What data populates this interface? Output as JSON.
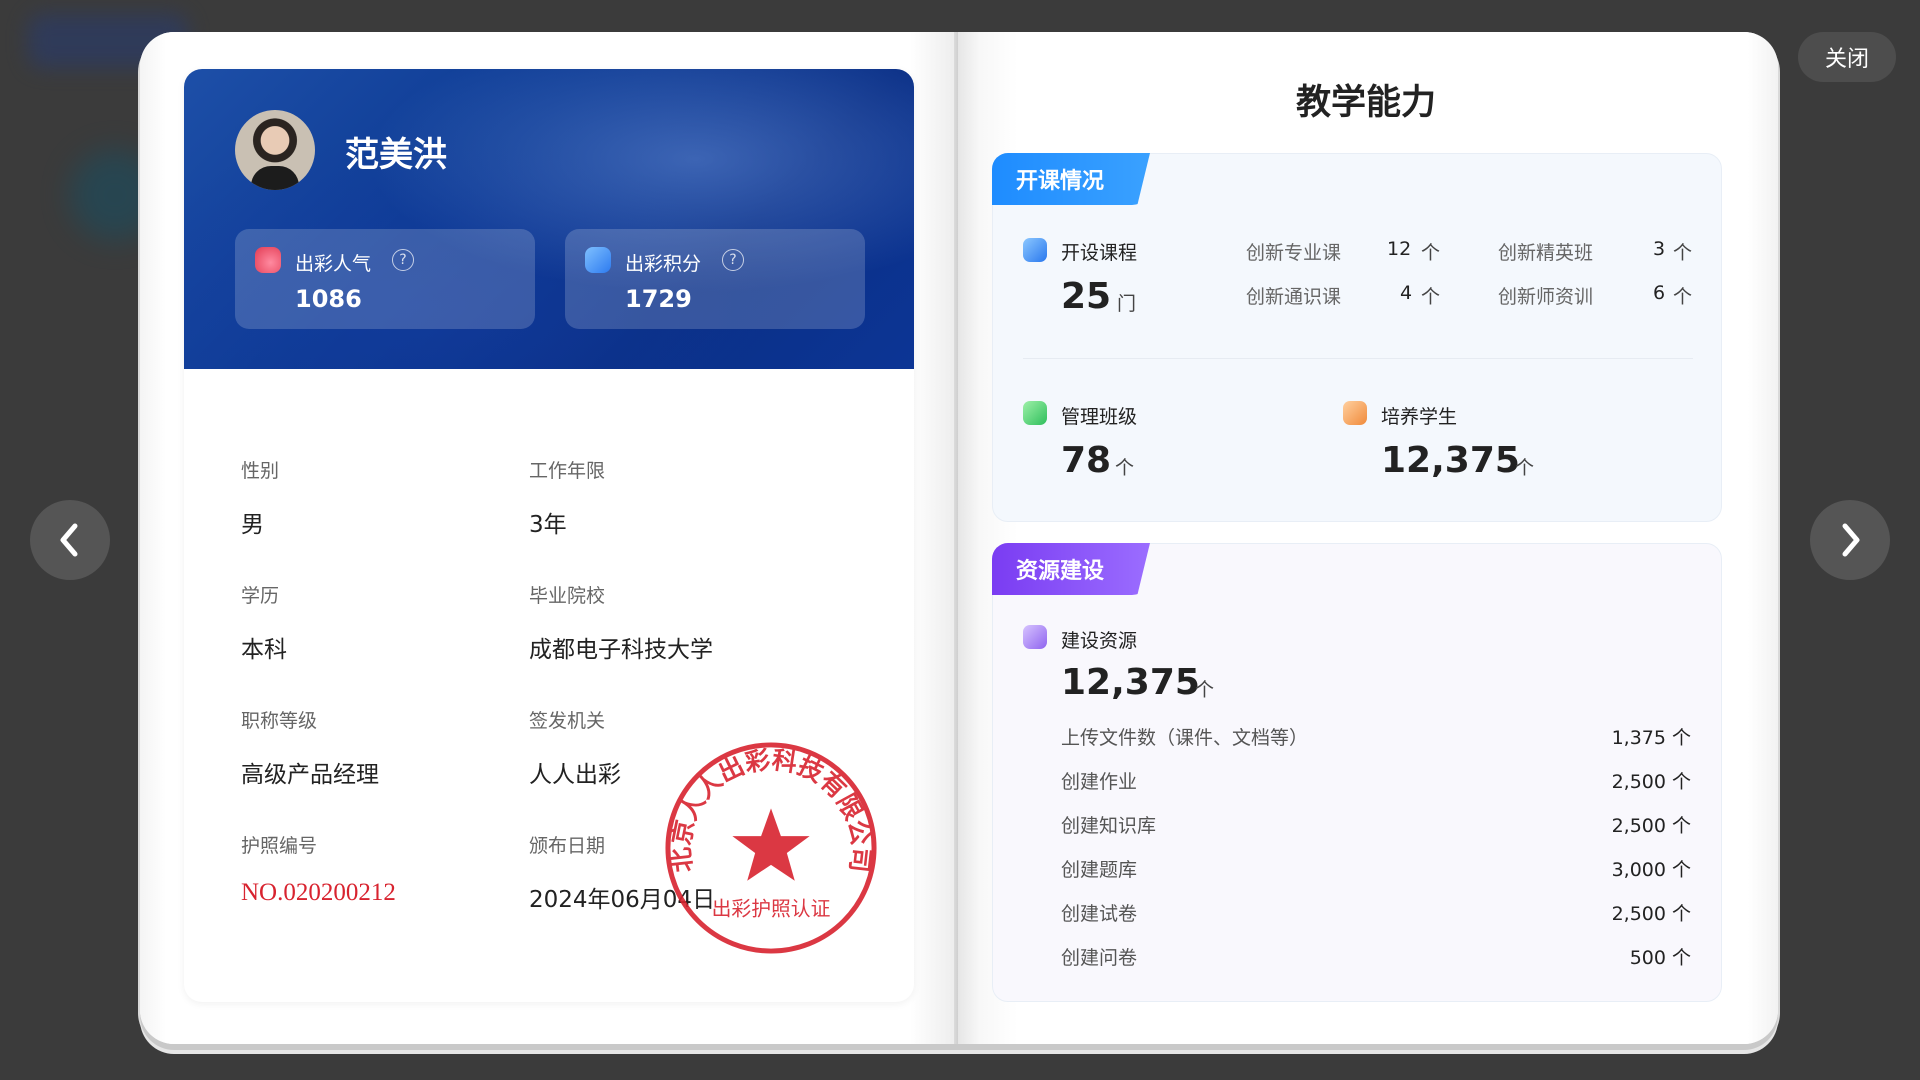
{
  "controls": {
    "close_label": "关闭"
  },
  "profile": {
    "name": "范美洪",
    "popularity_label": "出彩人气",
    "popularity_value": "1086",
    "points_label": "出彩积分",
    "points_value": "1729",
    "help_glyph": "?",
    "fields": [
      {
        "label": "性别",
        "value": "男"
      },
      {
        "label": "工作年限",
        "value": "3年"
      },
      {
        "label": "学历",
        "value": "本科"
      },
      {
        "label": "毕业院校",
        "value": "成都电子科技大学"
      },
      {
        "label": "职称等级",
        "value": "高级产品经理"
      },
      {
        "label": "签发机关",
        "value": "人人出彩"
      },
      {
        "label": "护照编号",
        "value": "NO.020200212"
      },
      {
        "label": "颁布日期",
        "value": "2024年06月04日"
      }
    ],
    "seal": {
      "company": "北京人人出彩科技有限公司",
      "sub": "出彩护照认证",
      "color": "#d8232f"
    }
  },
  "teaching": {
    "title": "教学能力",
    "courses": {
      "tag": "开课情况",
      "open_label": "开设课程",
      "open_value": "25",
      "open_unit": "门",
      "breakdown": [
        {
          "label": "创新专业课",
          "value": "12",
          "unit": "个"
        },
        {
          "label": "创新精英班",
          "value": "3",
          "unit": "个"
        },
        {
          "label": "创新通识课",
          "value": "4",
          "unit": "个"
        },
        {
          "label": "创新师资训",
          "value": "6",
          "unit": "个"
        }
      ],
      "classes_label": "管理班级",
      "classes_value": "78",
      "classes_unit": "个",
      "students_label": "培养学生",
      "students_value": "12,375",
      "students_unit": "个"
    },
    "resources": {
      "tag": "资源建设",
      "total_label": "建设资源",
      "total_value": "12,375",
      "total_unit": "个",
      "items": [
        {
          "label": "上传文件数（课件、文档等）",
          "value": "1,375 个"
        },
        {
          "label": "创建作业",
          "value": "2,500 个"
        },
        {
          "label": "创建知识库",
          "value": "2,500 个"
        },
        {
          "label": "创建题库",
          "value": "3,000 个"
        },
        {
          "label": "创建试卷",
          "value": "2,500 个"
        },
        {
          "label": "创建问卷",
          "value": "500 个"
        }
      ]
    }
  }
}
